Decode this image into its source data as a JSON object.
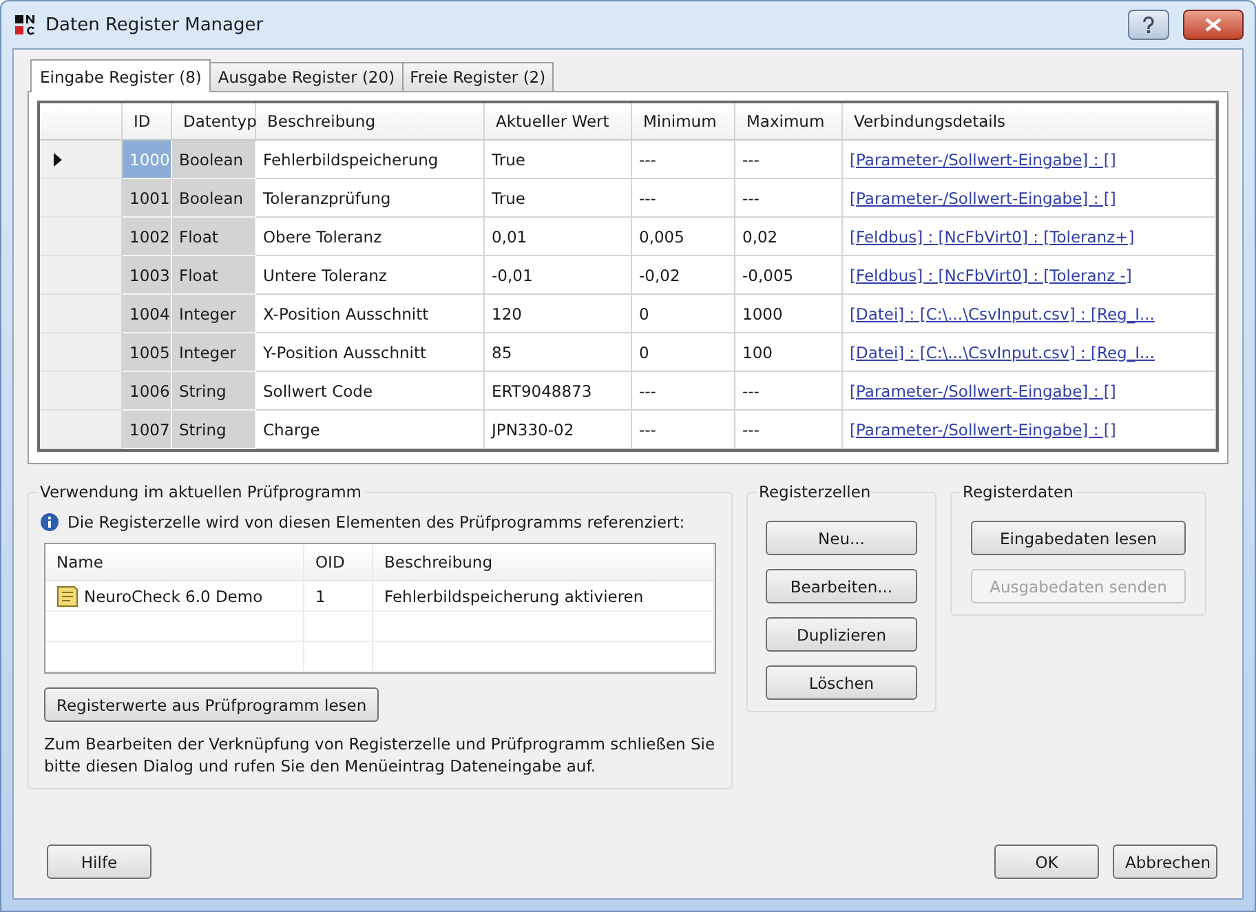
{
  "window": {
    "title": "Daten Register Manager"
  },
  "tabs": [
    {
      "label": "Eingabe Register (8)",
      "selected": true
    },
    {
      "label": "Ausgabe Register (20)",
      "selected": false
    },
    {
      "label": "Freie Register (2)",
      "selected": false
    }
  ],
  "table": {
    "columns": [
      "ID",
      "Datentyp",
      "Beschreibung",
      "Aktueller Wert",
      "Minimum",
      "Maximum",
      "Verbindungsdetails"
    ],
    "rows": [
      {
        "current": true,
        "selected": true,
        "cells": [
          "1000",
          "Boolean",
          "Fehlerbildspeicherung",
          "True",
          "---",
          "---",
          "[Parameter-/Sollwert-Eingabe] : []"
        ]
      },
      {
        "current": false,
        "selected": false,
        "cells": [
          "1001",
          "Boolean",
          "Toleranzprüfung",
          "True",
          "---",
          "---",
          "[Parameter-/Sollwert-Eingabe] : []"
        ]
      },
      {
        "current": false,
        "selected": false,
        "cells": [
          "1002",
          "Float",
          "Obere Toleranz",
          "0,01",
          "0,005",
          "0,02",
          "[Feldbus] : [NcFbVirt0] : [Toleranz+]"
        ]
      },
      {
        "current": false,
        "selected": false,
        "cells": [
          "1003",
          "Float",
          "Untere Toleranz",
          "-0,01",
          "-0,02",
          "-0,005",
          "[Feldbus] : [NcFbVirt0] : [Toleranz -]"
        ]
      },
      {
        "current": false,
        "selected": false,
        "cells": [
          "1004",
          "Integer",
          "X-Position Ausschnitt",
          "120",
          "0",
          "1000",
          "[Datei] : [C:\\...\\CsvInput.csv] : [Reg_I..."
        ]
      },
      {
        "current": false,
        "selected": false,
        "cells": [
          "1005",
          "Integer",
          "Y-Position Ausschnitt",
          "85",
          "0",
          "100",
          "[Datei] : [C:\\...\\CsvInput.csv] : [Reg_I..."
        ]
      },
      {
        "current": false,
        "selected": false,
        "cells": [
          "1006",
          "String",
          "Sollwert Code",
          "ERT9048873",
          "---",
          "---",
          "[Parameter-/Sollwert-Eingabe] : []"
        ]
      },
      {
        "current": false,
        "selected": false,
        "cells": [
          "1007",
          "String",
          "Charge",
          "JPN330-02",
          "---",
          "---",
          "[Parameter-/Sollwert-Eingabe] : []"
        ]
      }
    ]
  },
  "usage": {
    "title": "Verwendung im aktuellen Prüfprogramm",
    "info": "Die Registerzelle wird von diesen Elementen des Prüfprogramms referenziert:",
    "columns": [
      "Name",
      "OID",
      "Beschreibung"
    ],
    "rows": [
      {
        "cells": [
          "NeuroCheck 6.0 Demo",
          "1",
          "Fehlerbildspeicherung aktivieren"
        ]
      }
    ],
    "button": {
      "label": "Registerwerte aus Prüfprogramm lesen",
      "disabled": false
    },
    "note": "Zum Bearbeiten der Verknüpfung von Registerzelle und Prüfprogramm schließen Sie bitte diesen Dialog und rufen Sie den Menüeintrag Dateneingabe auf."
  },
  "registerzellen": {
    "title": "Registerzellen",
    "buttons": [
      {
        "label": "Neu...",
        "disabled": false
      },
      {
        "label": "Bearbeiten...",
        "disabled": false
      },
      {
        "label": "Duplizieren",
        "disabled": false
      },
      {
        "label": "Löschen",
        "disabled": false
      }
    ]
  },
  "registerdaten": {
    "title": "Registerdaten",
    "buttons": [
      {
        "label": "Eingabedaten lesen",
        "disabled": false
      },
      {
        "label": "Ausgabedaten senden",
        "disabled": true
      }
    ]
  },
  "footer": {
    "left": [
      {
        "label": "Hilfe",
        "disabled": false
      }
    ],
    "right": [
      {
        "label": "OK",
        "disabled": false
      },
      {
        "label": "Abbrechen",
        "disabled": false
      }
    ]
  }
}
